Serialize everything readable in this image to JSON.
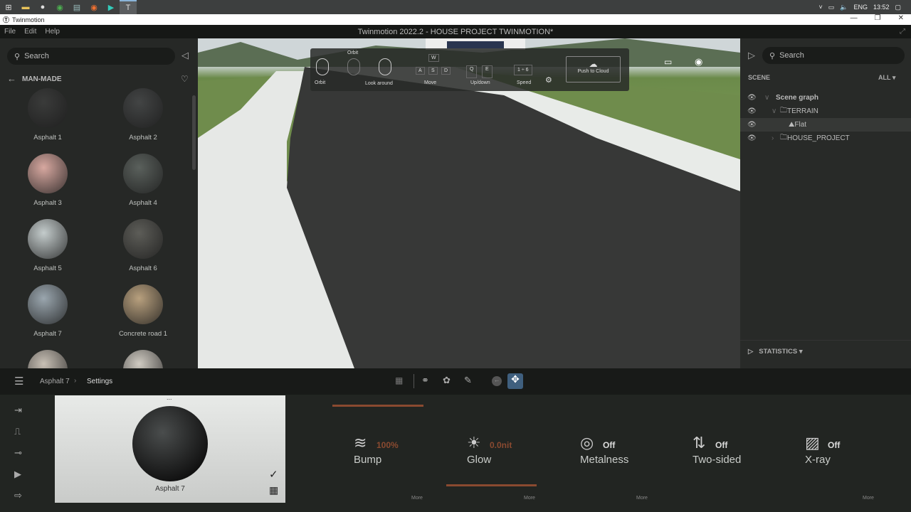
{
  "taskbar": {
    "icons": [
      "windows-start",
      "file-explorer",
      "app-generic",
      "chrome",
      "notepad",
      "firefox",
      "media-app",
      "twinmotion"
    ],
    "tray": {
      "language": "ENG",
      "time": "13:52"
    }
  },
  "window": {
    "app_name": "Twinmotion",
    "title": "Twinmotion 2022.2 - HOUSE PROJECT TWINMOTION*"
  },
  "menu": [
    "File",
    "Edit",
    "Help"
  ],
  "library": {
    "search_placeholder": "Search",
    "category": "MAN-MADE",
    "materials": [
      {
        "name": "Asphalt 1",
        "color": "#3a3b3a"
      },
      {
        "name": "Asphalt 2",
        "color": "#434545"
      },
      {
        "name": "Asphalt 3",
        "color": "#d7a8a0"
      },
      {
        "name": "Asphalt 4",
        "color": "#5a605c"
      },
      {
        "name": "Asphalt 5",
        "color": "#c4cccc"
      },
      {
        "name": "Asphalt 6",
        "color": "#5d5d58"
      },
      {
        "name": "Asphalt 7",
        "color": "#9aa6ae"
      },
      {
        "name": "Concrete road 1",
        "color": "#b8a07e"
      },
      {
        "name": "",
        "color": "#c8c0b5"
      },
      {
        "name": "",
        "color": "#d0cbc2"
      }
    ]
  },
  "hud": {
    "items": [
      "Orbit",
      "Orbit",
      "Look around",
      "Move",
      "Up/down",
      "Speed"
    ],
    "keys": {
      "w": "W",
      "a": "A",
      "s": "S",
      "d": "D",
      "q": "Q",
      "e": "E"
    },
    "speed": "1 ÷ 6",
    "push": "Push to Cloud"
  },
  "scene": {
    "search_placeholder": "Search",
    "title": "SCENE",
    "filter": "ALL",
    "tree": [
      "Scene graph",
      "TERRAIN",
      "Flat",
      "HOUSE_PROJECT"
    ],
    "statistics": "STATISTICS"
  },
  "breadcrumb": {
    "parent": "Asphalt 7",
    "current": "Settings"
  },
  "preview": {
    "name": "Asphalt 7",
    "dots": "..."
  },
  "properties": [
    {
      "label": "Bump",
      "value": "100%",
      "icon": "≋",
      "accent": true
    },
    {
      "label": "Glow",
      "value": "0.0nit",
      "icon": "☀",
      "accent": true
    },
    {
      "label": "Metalness",
      "value": "Off",
      "icon": "◎",
      "accent": false
    },
    {
      "label": "Two-sided",
      "value": "Off",
      "icon": "⇅",
      "accent": false
    },
    {
      "label": "X-ray",
      "value": "Off",
      "icon": "▨",
      "accent": false
    }
  ],
  "more_label": "More",
  "colors": {
    "accent": "#8a4a30",
    "active_tool": "#3f5f7e"
  }
}
